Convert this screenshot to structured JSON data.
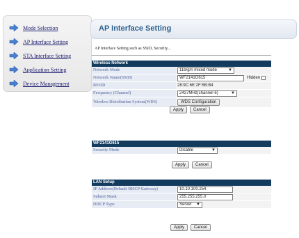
{
  "sidebar": {
    "items": [
      {
        "label": "Mode Selection"
      },
      {
        "label": "AP Interface Setting"
      },
      {
        "label": "STA Interface Setting"
      },
      {
        "label": "Application Setting"
      },
      {
        "label": "Device Management"
      }
    ]
  },
  "header": {
    "title": "AP Interface Setting",
    "description": "AP Interface Setting such as SSID, Security..."
  },
  "wireless": {
    "title": "Wireless Network",
    "mode_label": "Network Mode",
    "mode_value": "11b/g/n mixed mode",
    "ssid_label": "Network Name(SSID)",
    "ssid_value": "WF2141G615",
    "hidden_label": "Hidden",
    "bssid_label": "BSSID",
    "bssid_value": "28:9C:6E:2F:5B:B4",
    "freq_label": "Frequency (Channel)",
    "freq_value": "2437MHz(channel 6)",
    "wds_label": "Wireless Distribution System(WDS)",
    "wds_button": "WDS Configuration"
  },
  "security": {
    "title": "WF2141G615",
    "mode_label": "Security Mode",
    "mode_value": "Disable"
  },
  "lan": {
    "title": "LAN Setup",
    "ip_label": "IP Address(Default DHCP Gateway)",
    "ip_value": "10.10.100.254",
    "mask_label": "Subnet Mask",
    "mask_value": "255.255.255.0",
    "dhcp_label": "DHCP Type",
    "dhcp_value": "Server"
  },
  "buttons": {
    "apply": "Apply",
    "cancel": "Cancel"
  },
  "colors": {
    "section_header": "#123b5e",
    "label_bg": "#e6ebf4",
    "label_text": "#7a8bb5",
    "title_text": "#2b5f8c",
    "arrow": "#4a7fd0"
  }
}
